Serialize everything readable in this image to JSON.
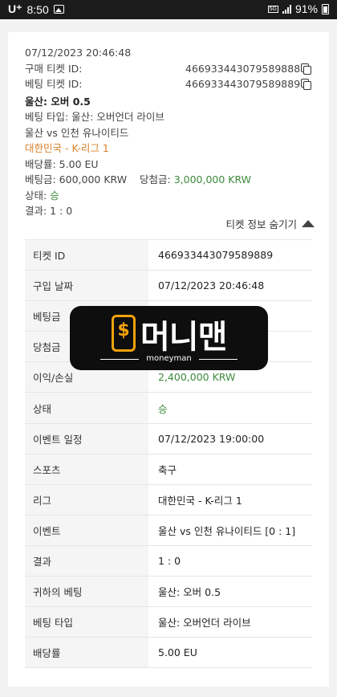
{
  "status_bar": {
    "carrier": "U⁺",
    "time": "8:50",
    "network": "5G",
    "battery": "91%"
  },
  "ticket": {
    "datetime": "07/12/2023 20:46:48",
    "purchase_id_label": "구매 티켓 ID:",
    "purchase_id": "466933443079589888",
    "bet_id_label": "베팅 티켓 ID:",
    "bet_id": "466933443079589889",
    "pick": "울산: 오버 0.5",
    "bet_type_line": "베팅 타입: 울산: 오버언더 라이브",
    "match": "울산 vs 인천 유나이티드",
    "league": "대한민국 - K-리그 1",
    "odds_line": "배당률: 5.00 EU",
    "stake_line": "베팅금: 600,000 KRW",
    "payout_label": "당첨금:",
    "payout_value": "3,000,000 KRW",
    "state_label": "상태:",
    "state_value": "승",
    "result_line": "결과: 1 : 0",
    "toggle_label": "티켓 정보 숨기기"
  },
  "details": [
    {
      "label": "티켓 ID",
      "value": "466933443079589889"
    },
    {
      "label": "구입 날짜",
      "value": "07/12/2023 20:46:48"
    },
    {
      "label": "베팅금",
      "value": ""
    },
    {
      "label": "당첨금",
      "value": ""
    },
    {
      "label": "이익/손실",
      "value": "2,400,000 KRW",
      "color": "#3c8a3c"
    },
    {
      "label": "상태",
      "value": "승",
      "color": "#3c8a3c"
    },
    {
      "label": "이벤트 일정",
      "value": "07/12/2023 19:00:00"
    },
    {
      "label": "스포츠",
      "value": "축구"
    },
    {
      "label": "리그",
      "value": "대한민국 - K-리그 1"
    },
    {
      "label": "이벤트",
      "value": "울산 vs 인천 유나이티드 [0 : 1]"
    },
    {
      "label": "결과",
      "value": "1 : 0"
    },
    {
      "label": "귀하의 베팅",
      "value": "울산: 오버 0.5"
    },
    {
      "label": "베팅 타입",
      "value": "울산: 오버언더 라이브"
    },
    {
      "label": "배당률",
      "value": "5.00 EU"
    }
  ],
  "watermark": {
    "symbol": "$",
    "title": "머니맨",
    "subtitle": "moneyman"
  },
  "colors": {
    "accent_orange": "#d9822b",
    "win_green": "#3c8a3c",
    "watermark_gold": "#f3a20c"
  }
}
